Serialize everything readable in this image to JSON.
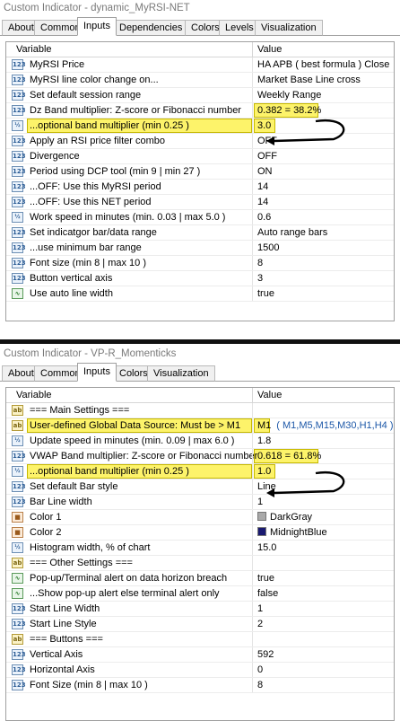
{
  "window1": {
    "title": "Custom Indicator - dynamic_MyRSI-NET",
    "tabs": [
      "About",
      "Common",
      "Inputs",
      "Dependencies",
      "Colors",
      "Levels",
      "Visualization"
    ],
    "active_tab": "Inputs",
    "headers": {
      "variable": "Variable",
      "value": "Value"
    },
    "rows": [
      {
        "icon": "123",
        "label": "MyRSI Price",
        "value": "HA APB ( best formula ) Close"
      },
      {
        "icon": "123",
        "label": "MyRSI line color change on...",
        "value": "Market Base Line cross"
      },
      {
        "icon": "123",
        "label": "Set default session range",
        "value": "Weekly Range"
      },
      {
        "icon": "123",
        "label": "Dz Band multiplier: Z-score or Fibonacci number",
        "value": "0.382 = 38.2%"
      },
      {
        "icon": "Va",
        "label": "...optional band multiplier (min 0.25 )",
        "value": "3.0"
      },
      {
        "icon": "123",
        "label": "Apply an RSI price filter combo",
        "value": "OFF"
      },
      {
        "icon": "123",
        "label": "Divergence",
        "value": "OFF"
      },
      {
        "icon": "123",
        "label": "Period using DCP tool (min 9 | min 27 )",
        "value": "ON"
      },
      {
        "icon": "123",
        "label": "...OFF: Use this MyRSI period",
        "value": "14"
      },
      {
        "icon": "123",
        "label": "...OFF: Use this NET period",
        "value": "14"
      },
      {
        "icon": "Va",
        "label": "Work speed in minutes (min. 0.03 | max 5.0 )",
        "value": "0.6"
      },
      {
        "icon": "123",
        "label": "Set indicatgor bar/data range",
        "value": "Auto range bars"
      },
      {
        "icon": "123",
        "label": "...use minimum bar range",
        "value": "1500"
      },
      {
        "icon": "123",
        "label": "Font size (min 8 | max 10 )",
        "value": "8"
      },
      {
        "icon": "123",
        "label": "Button vertical axis",
        "value": "3"
      },
      {
        "icon": "ln",
        "label": "Use auto line width",
        "value": "true"
      }
    ]
  },
  "window2": {
    "title": "Custom Indicator - VP-R_Momenticks",
    "tabs": [
      "About",
      "Common",
      "Inputs",
      "Colors",
      "Visualization"
    ],
    "active_tab": "Inputs",
    "headers": {
      "variable": "Variable",
      "value": "Value"
    },
    "rows": [
      {
        "icon": "ab",
        "label": "=== Main Settings ===",
        "value": ""
      },
      {
        "icon": "ab",
        "label": "User-defined Global Data Source: Must be > M1",
        "value": "M1",
        "value_note": "( M1,M5,M15,M30,H1,H4 )"
      },
      {
        "icon": "Va",
        "label": "Update speed in minutes (min. 0.09 | max 6.0 )",
        "value": "1.8"
      },
      {
        "icon": "123",
        "label": "VWAP Band multiplier: Z-score or Fibonacci number",
        "value": "0.618 = 61.8%"
      },
      {
        "icon": "Va",
        "label": "...optional band multiplier (min 0.25 )",
        "value": "1.0"
      },
      {
        "icon": "123",
        "label": "Set default Bar style",
        "value": "Line"
      },
      {
        "icon": "123",
        "label": "Bar Line width",
        "value": "1"
      },
      {
        "icon": "cl",
        "label": "Color 1",
        "value": "DarkGray",
        "swatch": "#a9a9a9"
      },
      {
        "icon": "cl",
        "label": "Color 2",
        "value": "MidnightBlue",
        "swatch": "#191970"
      },
      {
        "icon": "Va",
        "label": "Histogram width, % of chart",
        "value": "15.0"
      },
      {
        "icon": "ab",
        "label": "=== Other Settings ===",
        "value": ""
      },
      {
        "icon": "ln",
        "label": "Pop-up/Terminal alert on data horizon breach",
        "value": "true"
      },
      {
        "icon": "ln",
        "label": "...Show pop-up alert else terminal alert only",
        "value": "false"
      },
      {
        "icon": "123",
        "label": "Start Line Width",
        "value": "1"
      },
      {
        "icon": "123",
        "label": "Start Line Style",
        "value": "2"
      },
      {
        "icon": "ab",
        "label": "=== Buttons ===",
        "value": ""
      },
      {
        "icon": "123",
        "label": "Vertical Axis",
        "value": "592"
      },
      {
        "icon": "123",
        "label": "Horizontal Axis",
        "value": "0"
      },
      {
        "icon": "123",
        "label": "Font Size (min 8 | max 10 )",
        "value": "8"
      }
    ]
  },
  "colors": {
    "highlight": "#fdf36a",
    "highlight_border": "#c6b800",
    "divider": "#111111"
  }
}
